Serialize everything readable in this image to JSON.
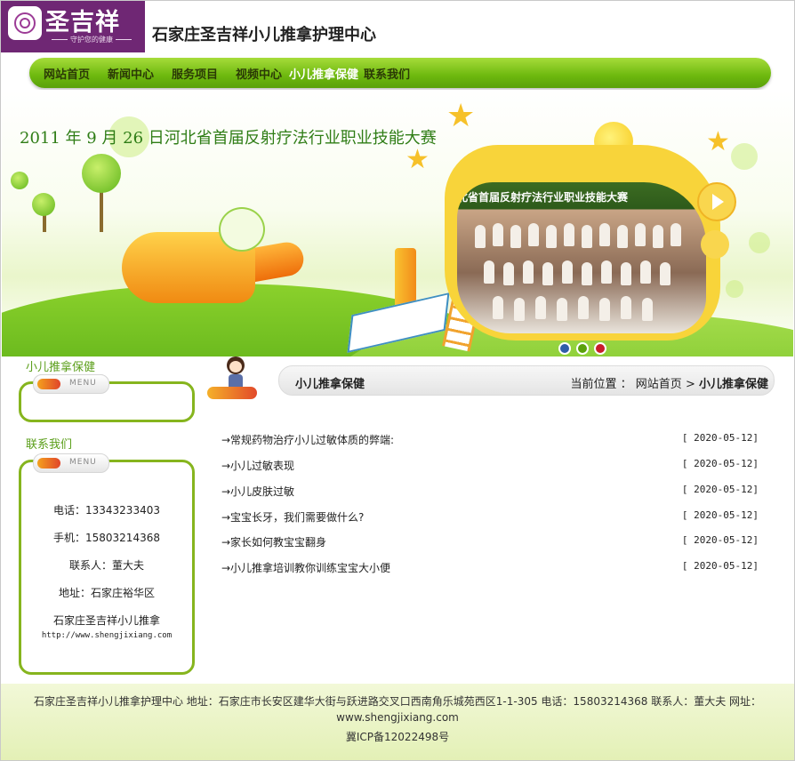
{
  "header": {
    "logo_name": "圣吉祥",
    "logo_slogan": "守护您的健康",
    "site_title": "石家庄圣吉祥小儿推拿护理中心"
  },
  "nav": {
    "items": [
      "网站首页",
      "新闻中心",
      "服务项目",
      "视频中心",
      "小儿推拿保健",
      "联系我们"
    ],
    "active": "小儿推拿保健"
  },
  "banner": {
    "title": "2011 年 9 月 26 日河北省首届反射疗法行业职业技能大赛",
    "photo_caption": "北省首届反射疗法行业职业技能大赛",
    "slide_count": 3,
    "slide_colors": [
      "#2f5ea8",
      "#5aa10a",
      "#c81e2a"
    ]
  },
  "sidebar": {
    "category_title": "小儿推拿保健",
    "menu_label": "MENU",
    "contact_title": "联系我们",
    "contact": {
      "phone": "电话：13343233403",
      "mobile": "手机：15803214368",
      "person": "联系人：董大夫",
      "address": "地址：石家庄裕华区",
      "company": "石家庄圣吉祥小儿推拿",
      "url": "http://www.shengjixiang.com"
    }
  },
  "main": {
    "section_title": "小儿推拿保健",
    "breadcrumb_prefix": "当前位置 ：",
    "breadcrumb_home": "网站首页",
    "breadcrumb_sep": ">",
    "breadcrumb_current": "小儿推拿保健",
    "news": [
      {
        "title": "→常规药物治疗小儿过敏体质的弊端:",
        "date": "[ 2020-05-12]"
      },
      {
        "title": "→小儿过敏表现",
        "date": "[ 2020-05-12]"
      },
      {
        "title": "→小儿皮肤过敏",
        "date": "[ 2020-05-12]"
      },
      {
        "title": "→宝宝长牙，我们需要做什么?",
        "date": "[ 2020-05-12]"
      },
      {
        "title": "→家长如何教宝宝翻身",
        "date": "[ 2020-05-12]"
      },
      {
        "title": "→小儿推拿培训教你训练宝宝大小便",
        "date": "[ 2020-05-12]"
      }
    ]
  },
  "footer": {
    "line1": "石家庄圣吉祥小儿推拿护理中心 地址：石家庄市长安区建华大街与跃进路交叉口西南角乐城苑西区1-1-305   电话：15803214368  联系人：董大夫        网址：",
    "line2": "www.shengjixiang.com",
    "line3": "冀ICP备12022498号"
  },
  "colors": {
    "brand_purple": "#6f2774",
    "nav_green": "#6db80e",
    "side_border": "#86b51e"
  }
}
